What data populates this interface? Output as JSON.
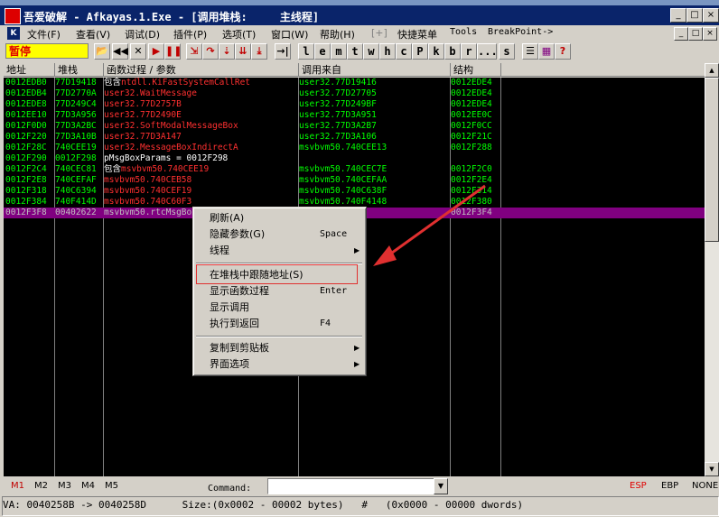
{
  "window": {
    "title": "吾爱破解 - Afkayas.1.Exe - [调用堆栈:     主线程]",
    "icon_label": "吾爱破解",
    "controls": [
      "_",
      "□",
      "×"
    ]
  },
  "menu": {
    "items": [
      "文件(F)",
      "查看(V)",
      "调试(D)",
      "插件(P)",
      "选项(T)",
      "窗口(W)",
      "帮助(H)",
      "[+]",
      "快捷菜单",
      "Tools",
      "BreakPoint->"
    ],
    "mdi_controls": [
      "_",
      "□",
      "×"
    ]
  },
  "toolbar": {
    "status": "暂停",
    "letter_buttons": [
      "l",
      "e",
      "m",
      "t",
      "w",
      "h",
      "c",
      "P",
      "k",
      "b",
      "r",
      "...",
      "s"
    ]
  },
  "columns": [
    "地址",
    "堆栈",
    "函数过程 / 参数",
    "调用来自",
    "结构"
  ],
  "rows": [
    {
      "addr": "0012EDB0",
      "stack": "77D19418",
      "proc_prefix": "包含",
      "proc": "ntdll.KiFastSystemCallRet",
      "from": "user32.77D19416",
      "frame": "0012EDE4"
    },
    {
      "addr": "0012EDB4",
      "stack": "77D2770A",
      "proc_prefix": "",
      "proc": "user32.WaitMessage",
      "from": "user32.77D27705",
      "frame": "0012EDE4"
    },
    {
      "addr": "0012EDE8",
      "stack": "77D249C4",
      "proc_prefix": "",
      "proc": "user32.77D2757B",
      "from": "user32.77D249BF",
      "frame": "0012EDE4"
    },
    {
      "addr": "0012EE10",
      "stack": "77D3A956",
      "proc_prefix": "",
      "proc": "user32.77D2490E",
      "from": "user32.77D3A951",
      "frame": "0012EE0C"
    },
    {
      "addr": "0012F0D0",
      "stack": "77D3A2BC",
      "proc_prefix": "",
      "proc": "user32.SoftModalMessageBox",
      "from": "user32.77D3A2B7",
      "frame": "0012F0CC"
    },
    {
      "addr": "0012F220",
      "stack": "77D3A10B",
      "proc_prefix": "",
      "proc": "user32.77D3A147",
      "from": "user32.77D3A106",
      "frame": "0012F21C"
    },
    {
      "addr": "0012F28C",
      "stack": "740CEE19",
      "proc_prefix": "",
      "proc": "user32.MessageBoxIndirectA",
      "from": "msvbvm50.740CEE13",
      "frame": "0012F288"
    },
    {
      "addr": "0012F290",
      "stack": "0012F298",
      "proc_prefix": "",
      "proc": "  pMsgBoxParams = 0012F298",
      "from": "",
      "frame": "",
      "param": true
    },
    {
      "addr": "0012F2C4",
      "stack": "740CEC81",
      "proc_prefix": "包含",
      "proc": "msvbvm50.740CEE19",
      "from": "msvbvm50.740CEC7E",
      "frame": "0012F2C0"
    },
    {
      "addr": "0012F2E8",
      "stack": "740CEFAF",
      "proc_prefix": "",
      "proc": "msvbvm50.740CEB58",
      "from": "msvbvm50.740CEFAA",
      "frame": "0012F2E4"
    },
    {
      "addr": "0012F318",
      "stack": "740C6394",
      "proc_prefix": "",
      "proc": "msvbvm50.740CEF19",
      "from": "msvbvm50.740C638F",
      "frame": "0012F314"
    },
    {
      "addr": "0012F384",
      "stack": "740F414D",
      "proc_prefix": "",
      "proc": "msvbvm50.740C60F3",
      "from": "msvbvm50.740F4148",
      "frame": "0012F380"
    },
    {
      "addr": "0012F3F8",
      "stack": "00402622",
      "proc_prefix": "",
      "proc": "msvbvm50.rtcMsgBox",
      "from": "0040261C",
      "frame": "0012F3F4",
      "selected": true
    }
  ],
  "context_menu": [
    {
      "label": "刷新(A)",
      "shortcut": "",
      "submenu": false
    },
    {
      "label": "隐藏参数(G)",
      "shortcut": "Space",
      "submenu": false
    },
    {
      "label": "线程",
      "shortcut": "",
      "submenu": true
    },
    {
      "separator": true
    },
    {
      "label": "在堆栈中跟随地址(S)",
      "shortcut": "",
      "submenu": false,
      "highlighted": true
    },
    {
      "label": "显示函数过程",
      "shortcut": "Enter",
      "submenu": false
    },
    {
      "label": "显示调用",
      "shortcut": "",
      "submenu": false
    },
    {
      "label": "执行到返回",
      "shortcut": "F4",
      "submenu": false
    },
    {
      "separator": true
    },
    {
      "label": "复制到剪贴板",
      "shortcut": "",
      "submenu": true
    },
    {
      "label": "界面选项",
      "shortcut": "",
      "submenu": true
    }
  ],
  "bottom": {
    "mtabs": [
      "M1",
      "M2",
      "M3",
      "M4",
      "M5"
    ],
    "command_label": "Command:",
    "regs": [
      "ESP",
      "EBP",
      "NONE"
    ]
  },
  "statusbar": {
    "text": "VA: 0040258B -> 0040258D      Size:(0x0002 - 00002 bytes)   #   (0x0000 - 00000 dwords)"
  },
  "colors": {
    "data_bg": "#000000",
    "addr": "#00ff00",
    "api": "#ff3030",
    "selected_row": "#800080",
    "annotation": "#e03030"
  }
}
